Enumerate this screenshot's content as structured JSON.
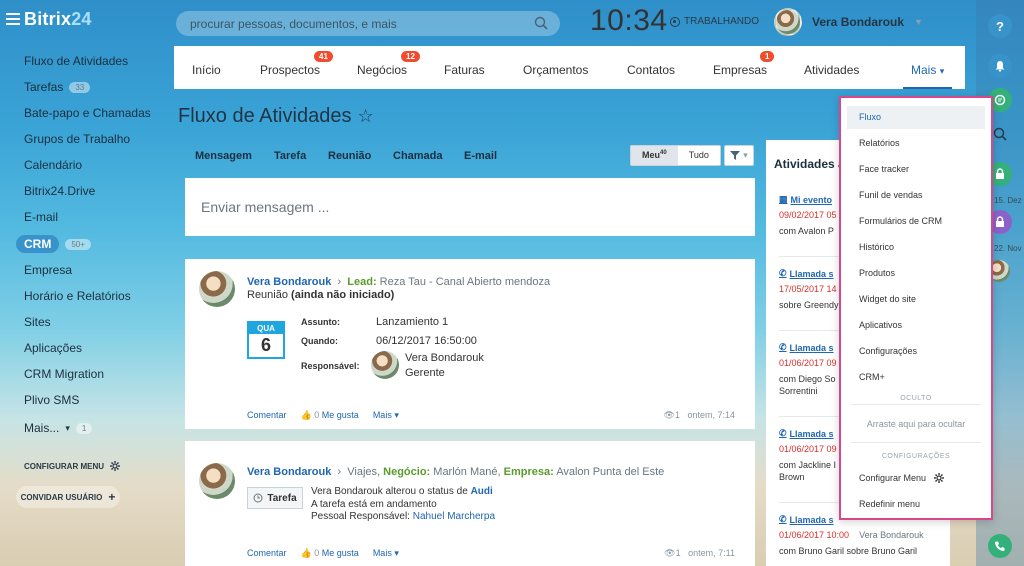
{
  "header": {
    "logo_main": "Bitrix",
    "logo_sub": "24",
    "search_placeholder": "procurar pessoas, documentos, e mais",
    "clock": "10:34",
    "status": "TRABALHANDO",
    "user_name": "Vera Bondarouk"
  },
  "sidebar": {
    "items": [
      {
        "label": "Fluxo de Atividades"
      },
      {
        "label": "Tarefas",
        "badge": "33"
      },
      {
        "label": "Bate-papo e Chamadas"
      },
      {
        "label": "Grupos de Trabalho"
      },
      {
        "label": "Calendário"
      },
      {
        "label": "Bitrix24.Drive"
      },
      {
        "label": "E-mail"
      },
      {
        "label": "CRM",
        "badge": "50+"
      },
      {
        "label": "Empresa"
      },
      {
        "label": "Horário e Relatórios"
      },
      {
        "label": "Sites"
      },
      {
        "label": "Aplicações"
      },
      {
        "label": "CRM Migration"
      },
      {
        "label": "Plivo SMS"
      },
      {
        "label": "Mais...",
        "badge": "1"
      }
    ],
    "configure_menu": "CONFIGURAR MENU",
    "invite_users": "CONVIDAR USUÁRIO"
  },
  "crm_tabs": [
    {
      "label": "Início"
    },
    {
      "label": "Prospectos",
      "counter": "41"
    },
    {
      "label": "Negócios",
      "counter": "12"
    },
    {
      "label": "Faturas"
    },
    {
      "label": "Orçamentos"
    },
    {
      "label": "Contatos"
    },
    {
      "label": "Empresas",
      "counter": "1"
    },
    {
      "label": "Atividades"
    },
    {
      "label": "Mais"
    }
  ],
  "page": {
    "title": "Fluxo de Atividades",
    "composer_tabs": [
      "Mensagem",
      "Tarefa",
      "Reunião",
      "Chamada",
      "E-mail"
    ],
    "filter_meu": "Meu",
    "filter_meu_count": "40",
    "filter_tudo": "Tudo",
    "composer_placeholder": "Enviar mensagem ..."
  },
  "posts": [
    {
      "author": "Vera Bondarouk",
      "lead_label": "Lead:",
      "lead_value": "Reza Tau - Canal Abierto mendoza",
      "subtitle": "Reunião",
      "subtitle_status": "(ainda não iniciado)",
      "cal_month": "QUA",
      "cal_day": "6",
      "subject_label": "Assunto:",
      "subject_value": "Lanzamiento 1",
      "when_label": "Quando:",
      "when_value": "06/12/2017 16:50:00",
      "resp_label": "Responsável:",
      "resp_name": "Vera Bondarouk",
      "resp_role": "Gerente",
      "comment": "Comentar",
      "like_count": "0",
      "like_label": "Me gusta",
      "more": "Mais",
      "views": "1",
      "time": "ontem, 7:14"
    },
    {
      "author": "Vera Bondarouk",
      "dest": "Viajes,",
      "deal_label": "Negócio:",
      "deal_value": "Marlón Mané,",
      "company_label": "Empresa:",
      "company_value": "Avalon Punta del Este",
      "tag": "Tarefa",
      "line1_pre": "Vera Bondarouk alterou o status de",
      "line1_link": "Audi",
      "line2": "A tarefa está em andamento",
      "line3_label": "Pessoal Responsável:",
      "line3_value": "Nahuel Marcherpa",
      "comment": "Comentar",
      "like_count": "0",
      "like_label": "Me gusta",
      "more": "Mais",
      "views": "1",
      "time": "ontem, 7:11"
    }
  ],
  "activities": {
    "title": "Atividades a",
    "items": [
      {
        "title": "Mi evento",
        "date": "09/02/2017 05",
        "text": "com Avalon P",
        "icon": "calendar-icon"
      },
      {
        "title": "Llamada s",
        "date": "17/05/2017 14",
        "text": "sobre Greendy",
        "icon": "phone-icon"
      },
      {
        "title": "Llamada s",
        "date": "01/06/2017 09",
        "text": "com Diego So\nSorrentini",
        "icon": "phone-icon"
      },
      {
        "title": "Llamada s",
        "date": "01/06/2017 09",
        "text": "com Jackline I\nBrown",
        "icon": "phone-icon"
      },
      {
        "title": "Llamada s",
        "date": "01/06/2017 10:00",
        "date_right": "Vera Bondarouk",
        "text": "com Bruno Garil sobre Bruno Garil",
        "icon": "phone-icon"
      }
    ]
  },
  "dropdown": {
    "items": [
      "Fluxo",
      "Relatórios",
      "Face tracker",
      "Funil de vendas",
      "Formulários de CRM",
      "Histórico",
      "Produtos",
      "Widget do site",
      "Aplicativos",
      "Configurações",
      "CRM+"
    ],
    "section_hidden": "OCULTO",
    "drop_hint": "Arraste aqui para ocultar",
    "section_settings": "CONFIGURAÇÕES",
    "configure_menu": "Configurar Menu",
    "reset_menu": "Redefinir menu"
  },
  "rail": {
    "date1": "15. Dez",
    "date2": "22. Nov"
  },
  "colors": {
    "accent": "#2067b0",
    "counter": "#f04d2f",
    "dropdown_border": "#d8468e",
    "crm_pill": "#3793c9"
  }
}
